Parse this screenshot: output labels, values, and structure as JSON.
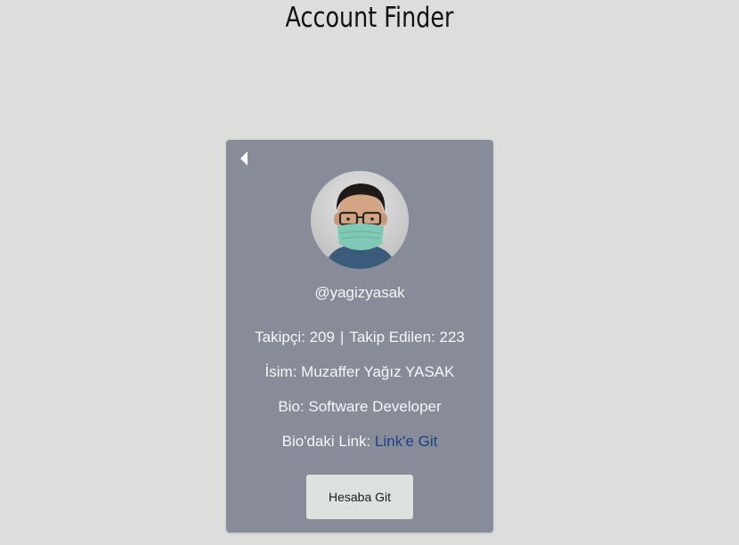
{
  "page": {
    "title": "Account Finder"
  },
  "profile": {
    "username": "@yagizyasak",
    "followers_label": "Takipçi:",
    "followers_value": "209",
    "separator": "|",
    "following_label": "Takip Edilen:",
    "following_value": "223",
    "name_label": "İsim:",
    "name_value": "Muzaffer Yağız YASAK",
    "bio_label": "Bio:",
    "bio_value": "Software Developer",
    "link_label": "Bio'daki Link:",
    "link_text": "Link'e Git"
  },
  "actions": {
    "back_icon": "caret-left-icon",
    "go_button_label": "Hesaba Git"
  },
  "colors": {
    "background": "#dcdedb",
    "card": "#878c98",
    "link": "#1c3f8a",
    "button": "#dde2de"
  }
}
